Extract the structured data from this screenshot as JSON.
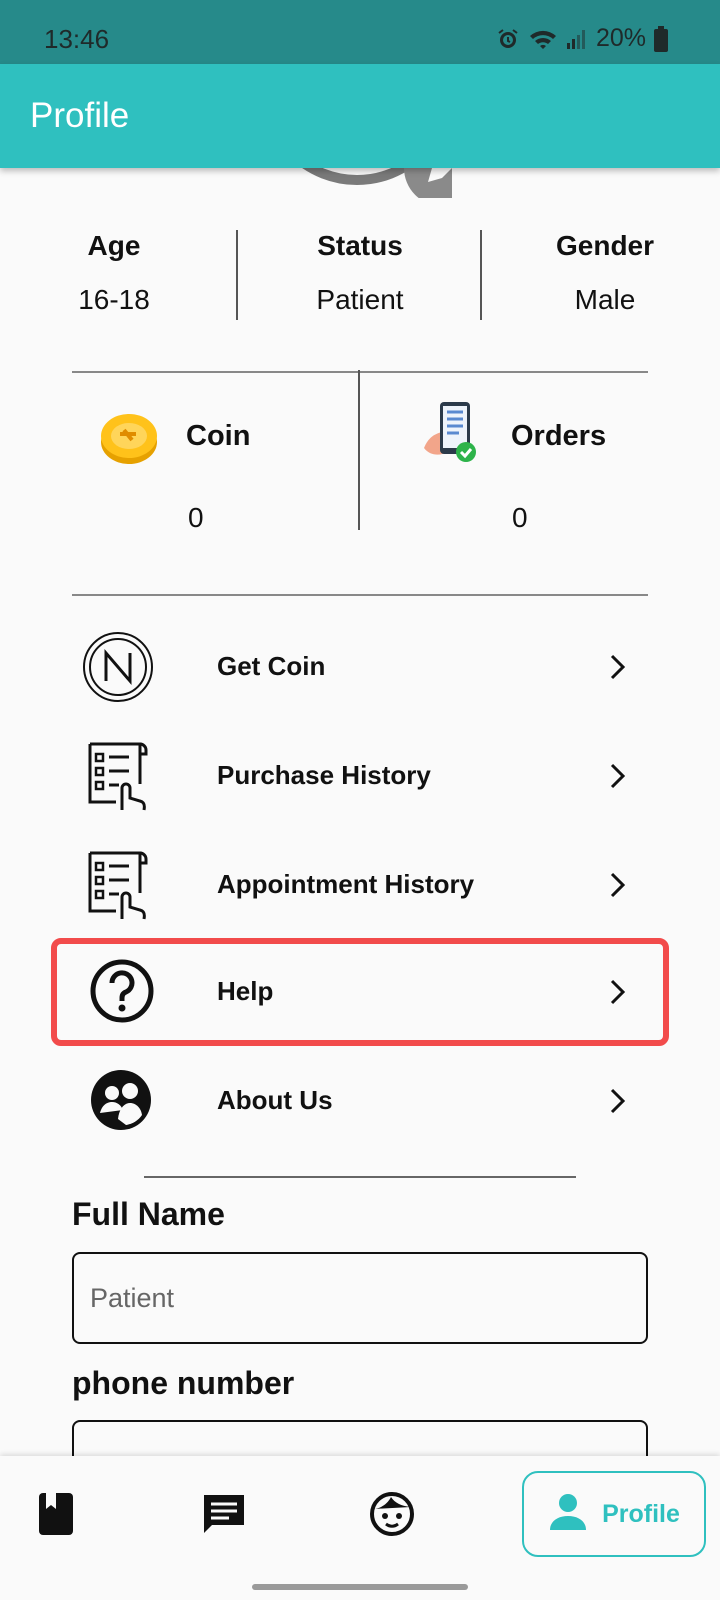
{
  "status_bar": {
    "time": "13:46",
    "battery": "20%"
  },
  "appbar": {
    "title": "Profile"
  },
  "stats": [
    {
      "label": "Age",
      "value": "16-18"
    },
    {
      "label": "Status",
      "value": "Patient"
    },
    {
      "label": "Gender",
      "value": "Male"
    }
  ],
  "cards": {
    "coin": {
      "label": "Coin",
      "value": "0",
      "icon": "coin-icon"
    },
    "orders": {
      "label": "Orders",
      "value": "0",
      "icon": "orders-icon"
    }
  },
  "menu": [
    {
      "label": "Get Coin",
      "icon": "n-logo-icon"
    },
    {
      "label": "Purchase History",
      "icon": "receipt-icon"
    },
    {
      "label": "Appointment History",
      "icon": "receipt-icon"
    },
    {
      "label": "Help",
      "icon": "help-icon",
      "highlighted": true
    },
    {
      "label": "About Us",
      "icon": "people-icon"
    }
  ],
  "form": {
    "full_name_label": "Full Name",
    "full_name_placeholder": "Patient",
    "phone_label": "phone number",
    "phone_value": ""
  },
  "bottom_nav": {
    "items": [
      "book-icon",
      "chat-icon",
      "face-icon",
      "person-icon"
    ],
    "active_label": "Profile"
  },
  "colors": {
    "primary": "#2fc0bf",
    "status_bar": "#268a8a",
    "highlight": "#f24b4b"
  }
}
